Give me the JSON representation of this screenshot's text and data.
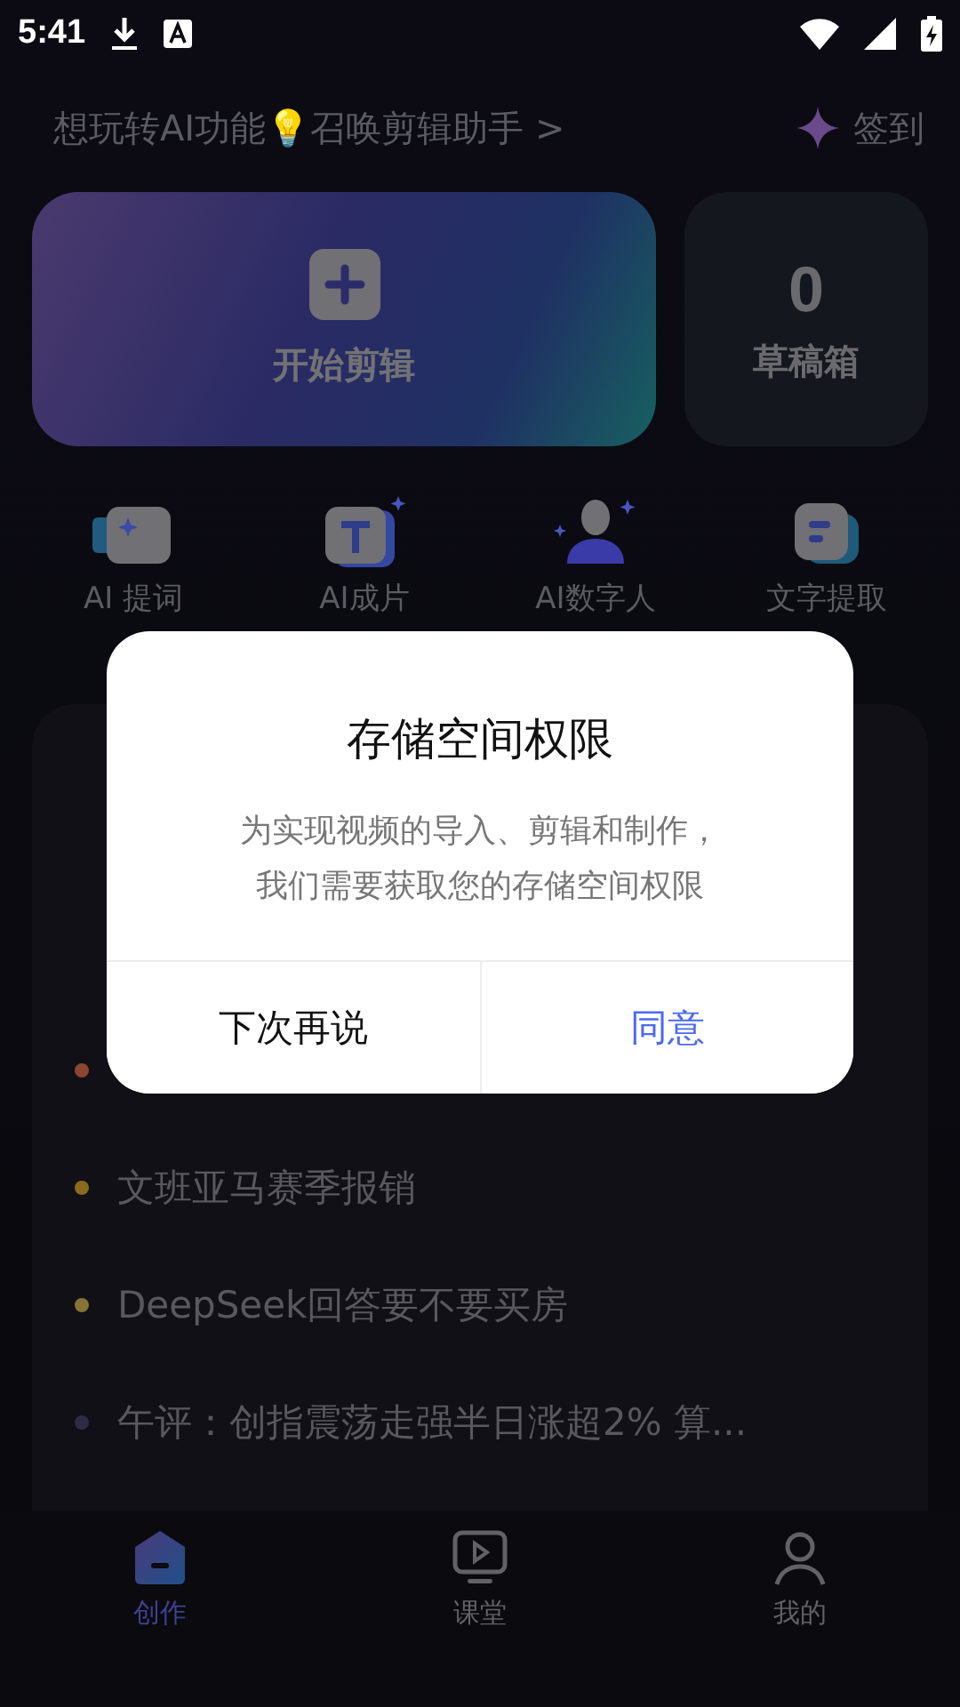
{
  "status_bar": {
    "time": "5:41"
  },
  "promo": {
    "text": "想玩转AI功能💡召唤剪辑助手 >",
    "checkin": "签到"
  },
  "start_card": {
    "label": "开始剪辑"
  },
  "drafts_card": {
    "count": "0",
    "label": "草稿箱"
  },
  "features": [
    {
      "kind": "prompter",
      "label": "AI 提词"
    },
    {
      "kind": "film",
      "label": "AI成片"
    },
    {
      "kind": "avatar",
      "label": "AI数字人"
    },
    {
      "kind": "extract",
      "label": "文字提取"
    }
  ],
  "hot_items": [
    {
      "color": "#8a4630"
    },
    {
      "color": "#8a6a1e",
      "text": "文班亚马赛季报销"
    },
    {
      "color": "#857436",
      "text": "DeepSeek回答要不要买房"
    },
    {
      "color": "#2e2c44",
      "text": "午评：创指震荡走强半日涨超2% 算..."
    }
  ],
  "tabs": [
    {
      "kind": "create",
      "label": "创作",
      "selected": true
    },
    {
      "kind": "class",
      "label": "课堂",
      "selected": false
    },
    {
      "kind": "me",
      "label": "我的",
      "selected": false
    }
  ],
  "dialog": {
    "title": "存储空间权限",
    "message_lines": [
      "为实现视频的导入、剪辑和制作，",
      "我们需要获取您的存储空间权限"
    ],
    "cancel": "下次再说",
    "confirm": "同意"
  }
}
